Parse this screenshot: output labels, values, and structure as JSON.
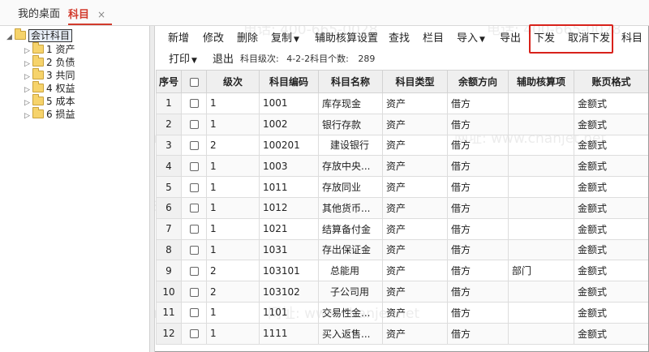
{
  "tabs": {
    "desktop": "我的桌面",
    "active": "科目",
    "close": "×"
  },
  "tree": {
    "root": "会计科目",
    "items": [
      "1 资产",
      "2 负债",
      "3 共同",
      "4 权益",
      "5 成本",
      "6 损益"
    ]
  },
  "toolbar": {
    "add": "新增",
    "edit": "修改",
    "delete": "删除",
    "copy": "复制",
    "aux_settings": "辅助核算设置",
    "find": "查找",
    "columns": "栏目",
    "import": "导入",
    "export": "导出",
    "issue": "下发",
    "cancel_issue": "取消下发",
    "more": "科目",
    "print": "打印",
    "exit": "退出"
  },
  "info": {
    "level_label": "科目级次:",
    "level_value": "4-2-2",
    "count_label": "科目个数:",
    "count_value": "289"
  },
  "table": {
    "headers": [
      "序号",
      "",
      "级次",
      "科目编码",
      "科目名称",
      "科目类型",
      "余额方向",
      "辅助核算项",
      "账页格式"
    ],
    "rows": [
      [
        "1",
        "1",
        "1001",
        "库存现金",
        "资产",
        "借方",
        "",
        "金额式"
      ],
      [
        "2",
        "1",
        "1002",
        "银行存款",
        "资产",
        "借方",
        "",
        "金额式"
      ],
      [
        "3",
        "2",
        "100201",
        "建设银行",
        "资产",
        "借方",
        "",
        "金额式"
      ],
      [
        "4",
        "1",
        "1003",
        "存放中央...",
        "资产",
        "借方",
        "",
        "金额式"
      ],
      [
        "5",
        "1",
        "1011",
        "存放同业",
        "资产",
        "借方",
        "",
        "金额式"
      ],
      [
        "6",
        "1",
        "1012",
        "其他货币...",
        "资产",
        "借方",
        "",
        "金额式"
      ],
      [
        "7",
        "1",
        "1021",
        "结算备付金",
        "资产",
        "借方",
        "",
        "金额式"
      ],
      [
        "8",
        "1",
        "1031",
        "存出保证金",
        "资产",
        "借方",
        "",
        "金额式"
      ],
      [
        "9",
        "2",
        "103101",
        "总能用",
        "资产",
        "借方",
        "部门",
        "金额式"
      ],
      [
        "10",
        "2",
        "103102",
        "子公司用",
        "资产",
        "借方",
        "",
        "金额式"
      ],
      [
        "11",
        "1",
        "1101",
        "交易性金...",
        "资产",
        "借方",
        "",
        "金额式"
      ],
      [
        "12",
        "1",
        "1111",
        "买入返售...",
        "资产",
        "借方",
        "",
        "金额式"
      ]
    ]
  },
  "watermark": {
    "phone": "电话: 400-665-0028",
    "site": "网址: www.chanjet.net"
  }
}
